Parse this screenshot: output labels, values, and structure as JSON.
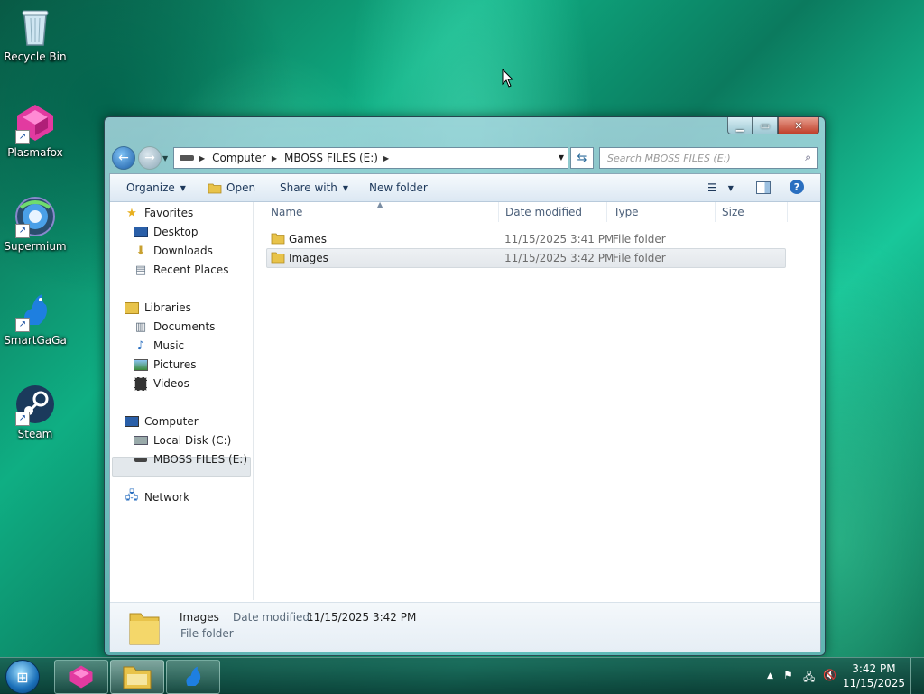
{
  "desktop": {
    "icons": [
      {
        "label": "Recycle Bin",
        "icon": "recycle-bin-icon"
      },
      {
        "label": "Plasmafox",
        "icon": "plasmafox-icon"
      },
      {
        "label": "Supermium",
        "icon": "supermium-icon"
      },
      {
        "label": "SmartGaGa",
        "icon": "smartgaga-icon"
      },
      {
        "label": "Steam",
        "icon": "steam-icon"
      }
    ]
  },
  "window": {
    "caption_buttons": {
      "minimize": "minimize-icon",
      "maximize": "maximize-icon",
      "close": "close-icon"
    },
    "address": {
      "crumbs": [
        "Computer",
        "MBOSS FILES (E:)"
      ]
    },
    "search": {
      "placeholder": "Search MBOSS FILES (E:)"
    },
    "toolbar": {
      "organize": "Organize",
      "open": "Open",
      "share_with": "Share with",
      "new_folder": "New folder"
    },
    "nav": {
      "favorites": "Favorites",
      "desktop": "Desktop",
      "downloads": "Downloads",
      "recent_places": "Recent Places",
      "libraries": "Libraries",
      "documents": "Documents",
      "music": "Music",
      "pictures": "Pictures",
      "videos": "Videos",
      "computer": "Computer",
      "local_disk": "Local Disk (C:)",
      "mboss": "MBOSS FILES (E:)",
      "network": "Network"
    },
    "columns": {
      "name": "Name",
      "date": "Date modified",
      "type": "Type",
      "size": "Size"
    },
    "files": [
      {
        "name": "Games",
        "date": "11/15/2025 3:41 PM",
        "type": "File folder",
        "selected": false
      },
      {
        "name": "Images",
        "date": "11/15/2025 3:42 PM",
        "type": "File folder",
        "selected": true
      }
    ],
    "details": {
      "name": "Images",
      "modified_label": "Date modified:",
      "modified_value": "11/15/2025 3:42 PM",
      "type": "File folder"
    },
    "colors": {
      "folder": "#e8c34a",
      "accent": "#1e395b"
    }
  },
  "taskbar": {
    "clock": {
      "time": "3:42 PM",
      "date": "11/15/2025"
    },
    "pinned": [
      "plasmafox-icon",
      "explorer-icon",
      "smartgaga-icon"
    ]
  }
}
